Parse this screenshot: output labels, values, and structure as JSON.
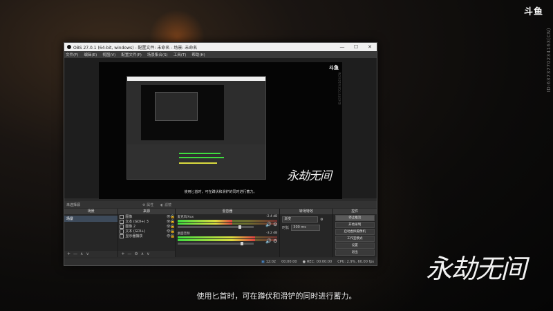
{
  "overlay": {
    "brand": "斗鱼",
    "room_id": "ID:6373770234163(CN)",
    "calligraphy": "永劫无间",
    "subtitle": "使用匕首时，可在蹲伏和滑铲的同时进行蓄力。"
  },
  "obs": {
    "title": "OBS 27.0.1 (64-bit, windows) - 配置文件: 未命名 - 场景: 未命名",
    "window_buttons": [
      "—",
      "☐",
      "✕"
    ],
    "menu": [
      "文件(F)",
      "编辑(E)",
      "视图(V)",
      "配置文件(P)",
      "场景集合(S)",
      "工具(T)",
      "帮助(H)"
    ],
    "preview": {
      "brand": "斗鱼",
      "room_id": "ID:6373770234163(CN)",
      "calligraphy": "永劫无间",
      "subtitle": "使用匕首时，可在蹲伏和滑铲的同时进行蓄力。"
    },
    "source_bar": {
      "no_selection": "未选择源",
      "properties": "属性",
      "filters": "滤镜"
    },
    "scenes": {
      "header": "场景",
      "items": [
        "场景"
      ],
      "footer": [
        "+",
        "—",
        "∧",
        "∨"
      ]
    },
    "sources": {
      "header": "来源",
      "items": [
        {
          "name": "图像",
          "eye": "👁",
          "lock": "🔓"
        },
        {
          "name": "文本 (GDI+) 3",
          "eye": "👁",
          "lock": "🔓"
        },
        {
          "name": "图像 2",
          "eye": "👁",
          "lock": "🔓"
        },
        {
          "name": "文本 (GDI+)",
          "eye": "👁",
          "lock": "🔓"
        },
        {
          "name": "显示器捕获",
          "eye": "👁",
          "lock": "🔓"
        }
      ],
      "footer": [
        "+",
        "—",
        "⚙",
        "∧",
        "∨"
      ]
    },
    "mixer": {
      "header": "混音器",
      "tracks": [
        {
          "name": "麦克风/Aux",
          "db": "-2.4 dB",
          "level": 0.55,
          "volume": 0.82
        },
        {
          "name": "桌面音频",
          "db": "-3.2 dB",
          "level": 0.78,
          "volume": 0.85
        }
      ],
      "icons": "🔊 ⚙"
    },
    "transitions": {
      "header": "转场特效",
      "type": "渐变",
      "duration_label": "时长",
      "duration": "300 ms"
    },
    "controls": {
      "header": "控件",
      "buttons": [
        "停止推流",
        "开始录制",
        "启动虚拟摄像机",
        "工作室模式",
        "设置",
        "退出"
      ]
    },
    "status": {
      "live_label": "LIVE:",
      "live_time": "12:02",
      "rec_time": "00:00:00",
      "rec_label": "REC:",
      "rec_value": "00:00:00",
      "cpu": "CPU: 2.9%, 60.00 fps"
    }
  },
  "colors": {
    "accent": "#4a8fd8",
    "meter_green": "#3fdc3f",
    "meter_yellow": "#dcdc3f",
    "meter_red": "#dc3f3f"
  }
}
